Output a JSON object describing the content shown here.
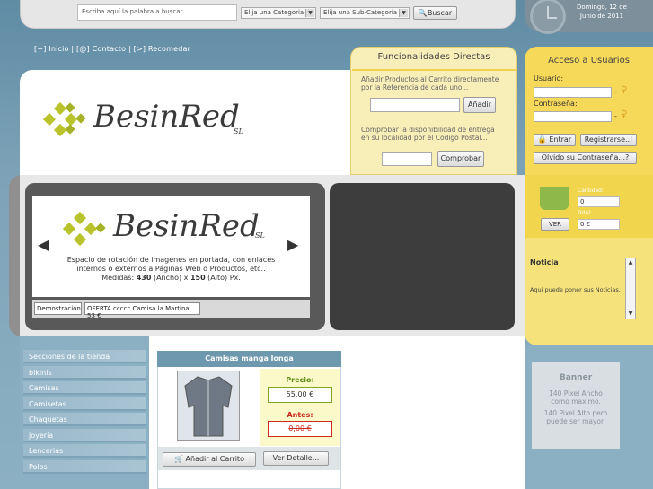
{
  "search": {
    "placeholder": "Escriba aquí la palabra a buscar...",
    "category_select": "Elija una Categoria",
    "subcategory_select": "Elija una Sub-Categoria",
    "button": "Buscar"
  },
  "date": {
    "line1": "Domingo, 12 de",
    "line2": "Junio de 2011"
  },
  "toplinks": "[+] Inicio | [@] Contacto | [>] Recomedar",
  "logo": {
    "main": "BesinRed",
    "suffix": "SL"
  },
  "funcionalidades": {
    "title": "Funcionalidades Directas",
    "add_text_1": "Añadir Productos al Carrito directamente",
    "add_text_2": "por la Referencia de cada uno...",
    "add_button": "Añadir",
    "check_text_1": "Comprobar la disponibilidad de entrega",
    "check_text_2": "en su localidad por el Codigo Postal...",
    "check_button": "Comprobar"
  },
  "acceso": {
    "title": "Acceso a Usuarios",
    "user_label": "Usuario:",
    "pass_label": "Contraseña:",
    "login_button": "Entrar",
    "register_button": "Registrarse..!",
    "forgot_button": "Olvido su Contraseña...?"
  },
  "slider": {
    "text_1": "Espacio de rotación de imagenes en portada, con enlaces",
    "text_2": "internos o externos a Páginas Web o Productos, etc..",
    "text_3_prefix": "Medidas: ",
    "width": "430",
    "text_3_mid": " (Ancho) x ",
    "height": "150",
    "text_3_suffix": " (Alto) Px.",
    "tabs": [
      "Demostración",
      "OFERTA ccccc Camisa la Martina 53 €"
    ]
  },
  "cart": {
    "qty_label": "Cantidad:",
    "qty_value": "0",
    "total_label": "Total:",
    "total_value": "0 €",
    "ver_button": "VER"
  },
  "noticia": {
    "title": "Noticia",
    "text": "Aquí puede poner sus Noticias."
  },
  "sidebar": {
    "items": [
      "Secciones de la tienda",
      "bikinis",
      "Camisas",
      "Camisetas",
      "Chaquetas",
      "joyeria",
      "Lencerias",
      "Polos"
    ]
  },
  "product": {
    "title": "Camisas manga longa",
    "price_label": "Precio:",
    "price": "55,00 €",
    "before_label": "Antes:",
    "before_price": "0,00 €",
    "cart_button": "Añadir al Carrito",
    "detail_button": "Ver Detalle..."
  },
  "banner": {
    "title": "Banner",
    "line1": "140 Pixel Ancho",
    "line2": "como maximo.",
    "line3": "140 Pixel Alto pero",
    "line4": "puede ser mayor."
  }
}
